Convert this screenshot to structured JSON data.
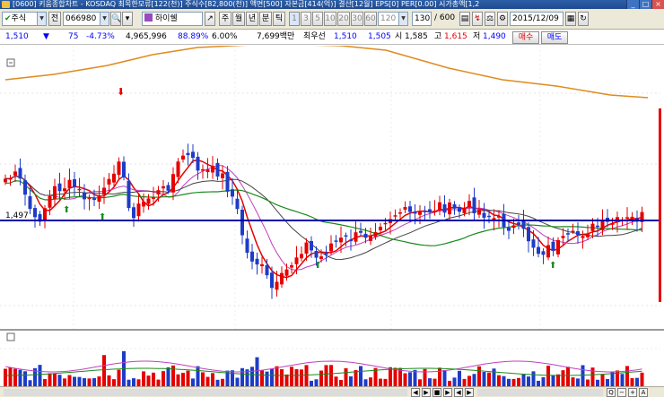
{
  "window": {
    "title": "[0600] 키움종합차트 - KOSDAQ 최목한모류[122(천)] 주식수[82,800(천)] 액면[500] 자본금[414(억)] 결산[12월] EPS[0] PER[0.00] 시가총액[1,2"
  },
  "toolbar": {
    "market": "주식",
    "jeon_label": "전",
    "code": "066980",
    "stock_name": "하이쉘",
    "periods": [
      "주",
      "월",
      "년",
      "분",
      "틱"
    ],
    "minute_options": [
      "1",
      "3",
      "5",
      "10",
      "20",
      "30",
      "60",
      "120"
    ],
    "count": "130",
    "count_total": "/ 600",
    "date": "2015/12/09"
  },
  "info": {
    "price": "1,510",
    "change_arrow": "▼",
    "change": "75",
    "change_pct": "-4.73%",
    "volume": "4,965,996",
    "vol_ratio": "88.89%",
    "turnover": "6.00%",
    "amount": "7,699백만",
    "choiwoo_label": "최우선",
    "best_ask": "1,510",
    "best_bid": "1,505",
    "open_label": "시",
    "open": "1,585",
    "high_label": "고",
    "high": "1,615",
    "low_label": "저",
    "low": "1,490",
    "buy_label": "매수",
    "sell_label": "매도"
  },
  "chart": {
    "price_line_label": "1,497",
    "colors": {
      "up": "#e60000",
      "down": "#1e3cc8",
      "ma5": "#e60000",
      "ma10": "#c040c0",
      "ma20": "#444444",
      "ma60": "#1a8a1a",
      "ma120": "#e08a1e",
      "hline": "#0000aa"
    }
  },
  "status": {
    "buttons": [
      "◀",
      "▶",
      "■",
      "▶",
      "◀",
      "▶",
      "Q",
      "−",
      "+",
      "A"
    ]
  }
}
